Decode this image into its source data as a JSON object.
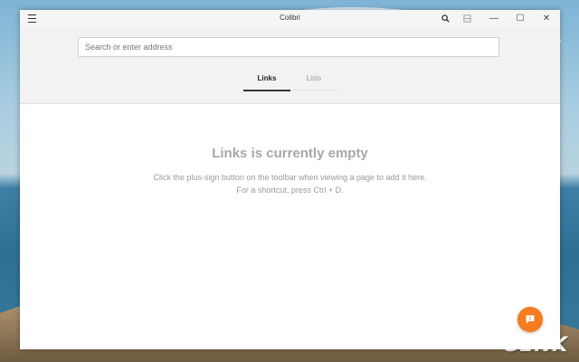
{
  "window": {
    "title": "Colibri"
  },
  "titlebar": {
    "menu_icon": "hamburger-icon",
    "search_icon": "search-icon",
    "tabs_icon": "tabs-icon",
    "minimize_glyph": "—",
    "maximize_glyph": "☐",
    "close_glyph": "✕"
  },
  "address_bar": {
    "placeholder": "Search or enter address",
    "value": ""
  },
  "tabs": [
    {
      "label": "Links",
      "active": true
    },
    {
      "label": "Lists",
      "active": false
    }
  ],
  "empty_state": {
    "title": "Links is currently empty",
    "line1": "Click the plus-sign button on the toolbar when viewing a page to add it here.",
    "line2": "For a shortcut, press Ctrl + D."
  },
  "fab": {
    "icon": "feedback-icon",
    "color": "#f57c1f"
  },
  "watermark": {
    "text": "GENK"
  },
  "colors": {
    "accent": "#f57c1f",
    "header_bg": "#f2f2f2",
    "empty_text": "#a7a7a7"
  }
}
